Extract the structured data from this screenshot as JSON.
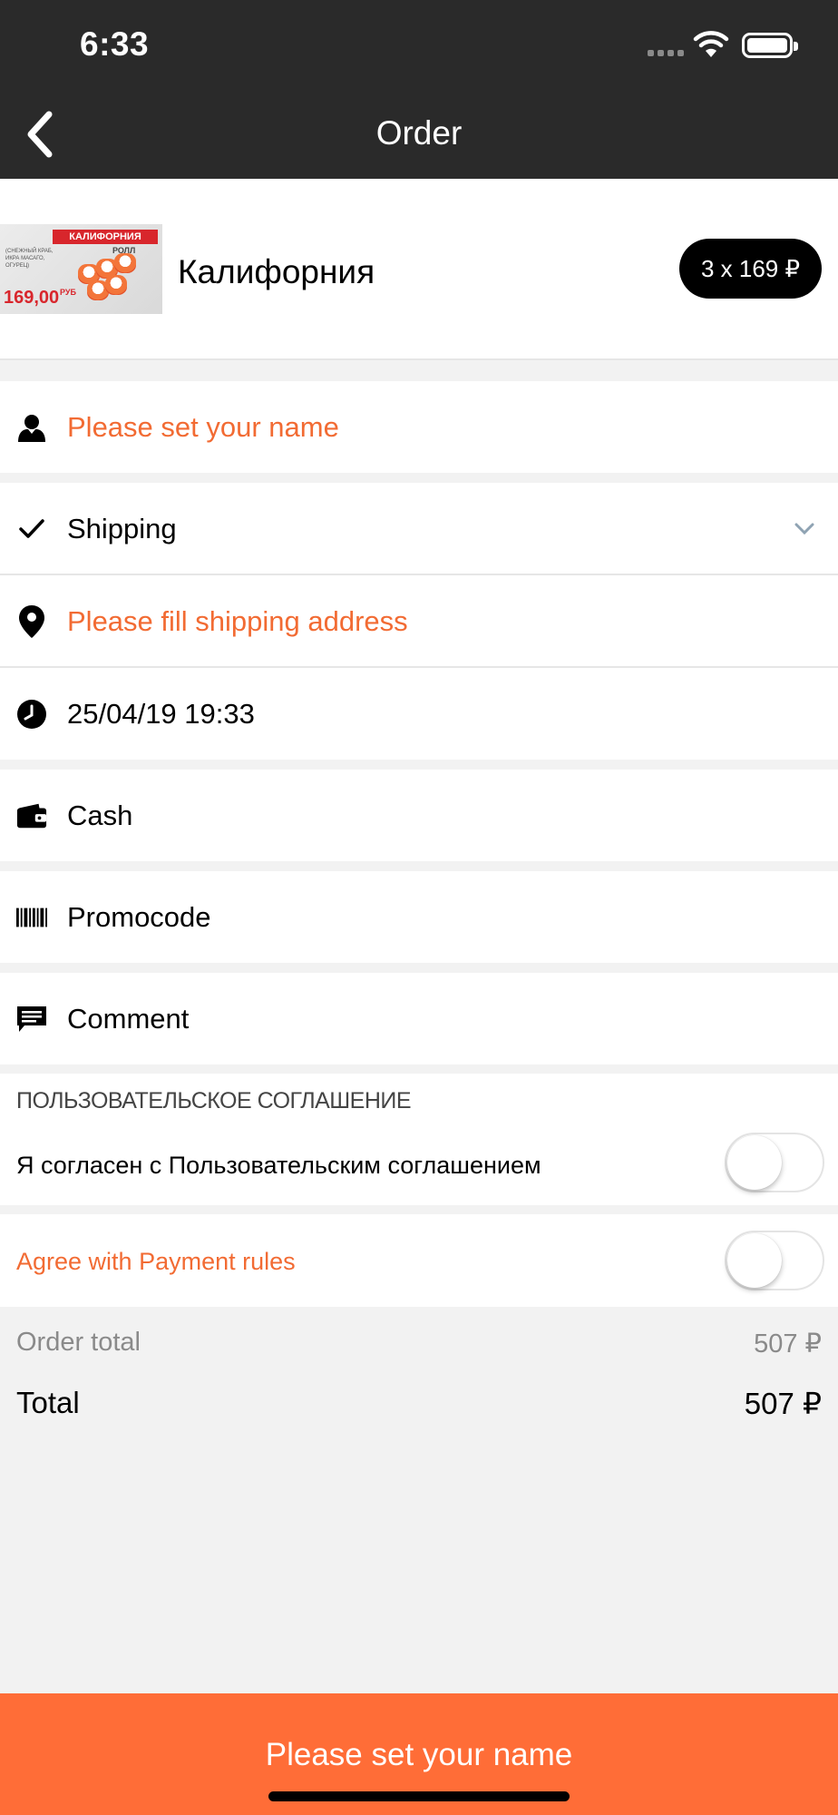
{
  "status_bar": {
    "time": "6:33"
  },
  "nav": {
    "title": "Order"
  },
  "product": {
    "image_title": "КАЛИФОРНИЯ",
    "image_subtitle": "РОЛЛ",
    "image_desc": "(СНЕЖНЫЙ КРАБ, ИКРА МАСАГО, ОГУРЕЦ)",
    "image_price": "169,00",
    "image_currency": "РУБ",
    "name": "Калифорния",
    "qty_price": "3 x 169 ₽"
  },
  "form": {
    "name_prompt": "Please set your name",
    "shipping": "Shipping",
    "address_prompt": "Please fill shipping address",
    "datetime": "25/04/19 19:33",
    "payment": "Cash",
    "promocode": "Promocode",
    "comment": "Comment"
  },
  "agreement": {
    "header": "ПОЛЬЗОВАТЕЛЬСКОЕ СОГЛАШЕНИЕ",
    "text": "Я согласен с Пользовательским соглашением",
    "enabled": false
  },
  "payment_rules": {
    "text": "Agree with Payment rules",
    "enabled": false
  },
  "totals": {
    "order_total_label": "Order total",
    "order_total_value": "507 ₽",
    "total_label": "Total",
    "total_value": "507 ₽"
  },
  "cta": {
    "label": "Please set your name"
  },
  "colors": {
    "accent": "#f26b33",
    "cta": "#ff6d37",
    "topbar": "#2a2a2a"
  }
}
